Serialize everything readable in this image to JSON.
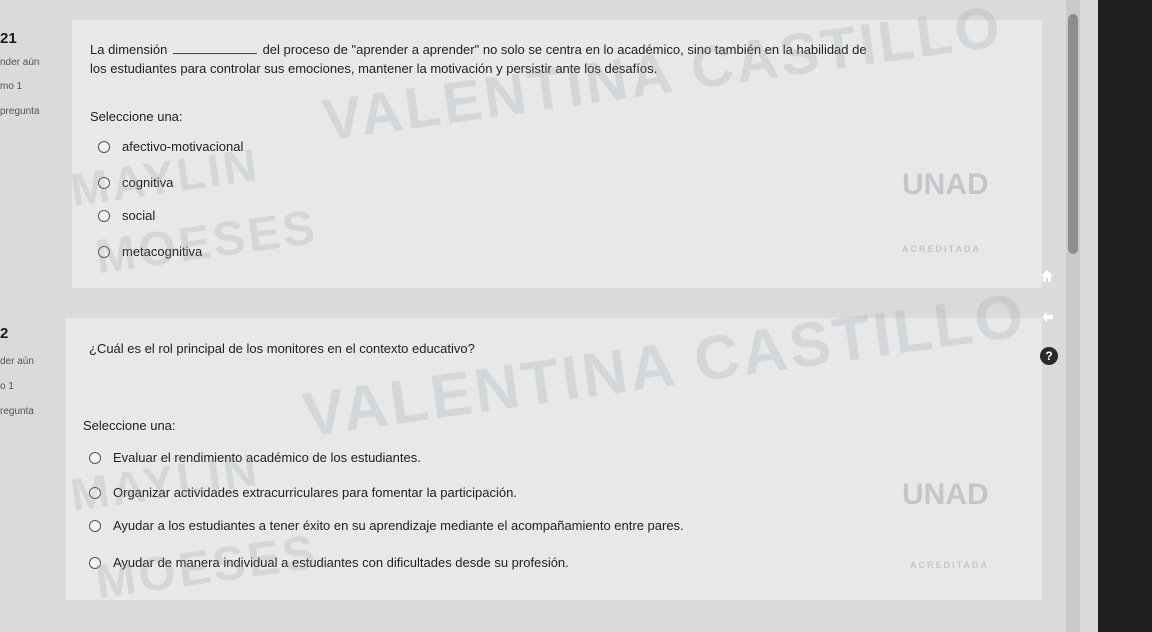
{
  "q1": {
    "number": "21",
    "meta1": "nder aún",
    "meta2": "mo 1",
    "meta3": "pregunta",
    "text_before": "La dimensión",
    "text_after": "del proceso de \"aprender a aprender\" no solo se centra en lo académico, sino también en la habilidad de",
    "text_line2": "los estudiantes para controlar sus emociones, mantener la motivación y persistir ante los desafíos.",
    "prompt": "Seleccione una:",
    "options": [
      "afectivo-motivacional",
      "cognitiva",
      "social",
      "metacognitiva"
    ]
  },
  "q2": {
    "number": "2",
    "meta1": "der aún",
    "meta2": "o 1",
    "meta3": "regunta",
    "text": "¿Cuál es el rol principal de los monitores en el contexto educativo?",
    "prompt": "Seleccione una:",
    "options": [
      "Evaluar el rendimiento académico de los estudiantes.",
      "Organizar actividades extracurriculares para fomentar la participación.",
      "Ayudar a los estudiantes a tener éxito en su aprendizaje mediante el acompañamiento entre pares.",
      "Ayudar de manera individual a estudiantes con dificultades desde su profesión."
    ]
  },
  "watermarks": [
    "VALENTINA CASTILLO",
    "MAYLIN",
    "MOESES",
    "VALENTINA CASTILLO",
    "MAYLIN",
    "MOESES"
  ],
  "logo": {
    "text": "UNAD",
    "tagline": "ACREDITADA"
  },
  "icons": {
    "home": "home-icon",
    "back": "arrow-left-icon",
    "help": "help-icon"
  },
  "colors": {
    "panel": "#e6e8e9",
    "background": "#d9dadb",
    "sidebar": "#1e1f21"
  }
}
